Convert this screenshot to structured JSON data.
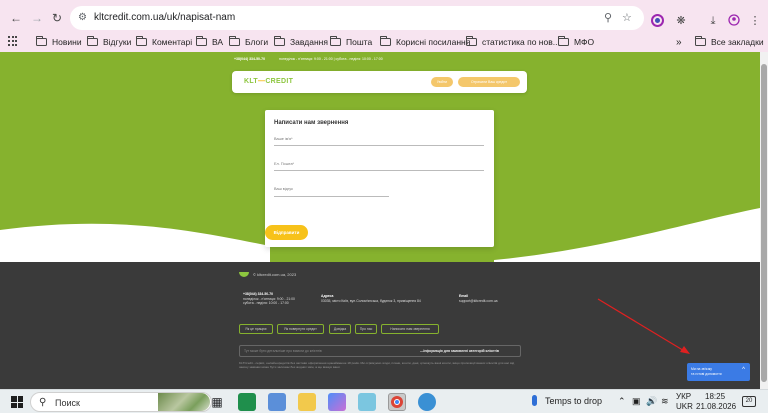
{
  "browser": {
    "url": "kltcredit.com.ua/uk/napisat-nam",
    "bookmarks": [
      "Новини",
      "Відгуки",
      "Коментарі",
      "ВА",
      "Блоги",
      "Завдання",
      "Пошта",
      "Корисні посилання",
      "статистика по нов...",
      "МФО"
    ],
    "all_bookmarks": "Все закладки",
    "more": "»"
  },
  "site": {
    "topbar_phone": "+38(044) 334-50-70",
    "topbar_hours": "понеділок - п'ятниця: 9:00 - 21:00 | субота - неділя: 10:00 - 17:00",
    "logo_prefix": "KLT",
    "logo_dash": "—",
    "logo_suffix": "CREDIT",
    "login_btn": "Увійти",
    "apply_btn": "Отримати Ваш кредит"
  },
  "form": {
    "title": "Написати нам звернення",
    "name_label": "Ваше ім'я*",
    "email_label": "Ел. Пошта*",
    "question_label": "Ваш відгук",
    "submit_label": "Відправити"
  },
  "footer": {
    "copyright": "© kltcredit.com.ua, 2023",
    "phone": "+38(044) 334-50-70",
    "hours1": "понеділок - п'ятниця: 9:00 - 21:00",
    "hours2": "субота - неділя: 10:00 - 17:00",
    "address_title": "Адреса",
    "address": "03035, місто Київ, вул.Солом'янська, будинок 3, приміщення 84",
    "email_title": "Email",
    "email": "support@kltcredit.com.ua",
    "links": [
      "Як це працює",
      "Як повернути кредит",
      "Довідка",
      "Про нас",
      "Написати нам звернення"
    ],
    "input_placeholder": "Тут може бути детальніше про вимоги до клієнтів",
    "info_link": "—Інформація для замовлені категорій клієнтів",
    "legal": "KLTCredit - сервіс, онлайн-кредитів без застави оформлення щонайменше 18 років. Ми отримуємо згоди, плани, кошти, дані, ці можуть ваші кошти, якщо пропозиції ваших клієнтів для нас від закону заявник може бути залишає без жодних змін, а ще вказує ваші."
  },
  "chat": {
    "line1": "Ми на зв'язку",
    "line2": "та готові допомогти",
    "ctrl": "^"
  },
  "taskbar": {
    "search_text": "Поиск",
    "temp": "Temps to drop",
    "lang1": "УКР",
    "lang2": "UKR",
    "time": "18:25",
    "date": "21.08.2026",
    "notif": "20"
  }
}
